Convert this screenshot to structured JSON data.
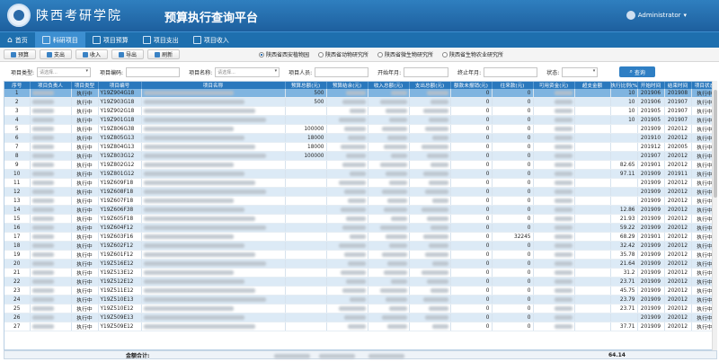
{
  "header": {
    "logo_text": "陕西考研学院",
    "title": "预算执行查询平台",
    "user": "Administrator"
  },
  "nav": [
    {
      "label": "首页",
      "icon": "home-icon"
    },
    {
      "label": "科研项目",
      "icon": "grid-icon"
    },
    {
      "label": "项目预算",
      "icon": "grid-icon"
    },
    {
      "label": "项目支出",
      "icon": "grid-icon"
    },
    {
      "label": "项目收入",
      "icon": "grid-icon"
    }
  ],
  "toolbar": {
    "buttons": [
      "预算",
      "支出",
      "收入",
      "导出",
      "刷新"
    ],
    "radios": [
      "陕西省西安植物园",
      "陕西省动物研究所",
      "陕西省微生物研究所",
      "陕西省生物农业研究所"
    ]
  },
  "filters": {
    "type_label": "项目类型:",
    "type_placeholder": "请选择...",
    "code_label": "项目编码:",
    "name_label": "项目名称:",
    "name_placeholder": "请选择...",
    "person_label": "项目人员:",
    "start_label": "开始年月:",
    "end_label": "终止年月:",
    "status_label": "状态:",
    "query_label": "查询"
  },
  "table": {
    "headers": [
      "序号",
      "项目负责人",
      "项目类型",
      "项目编号",
      "项目名称",
      "预算总额(元)",
      "预算结余(元)",
      "收入总额(元)",
      "支出总额(元)",
      "额款未报销(元)",
      "往来款(元)",
      "可用资金(元)",
      "超支金额",
      "执行比例(%)",
      "开始时间",
      "结束时间",
      "项目状态"
    ],
    "rows": [
      {
        "n": "1",
        "type": "执行中",
        "code": "Y19Z904G18",
        "budget": "500",
        "c8": "0",
        "c9": "0",
        "ratio": "10",
        "start": "201906",
        "end": "201908",
        "status": "执行中"
      },
      {
        "n": "2",
        "type": "执行中",
        "code": "Y19Z903G18",
        "budget": "500",
        "c8": "0",
        "c9": "0",
        "ratio": "10",
        "start": "201906",
        "end": "201907",
        "status": "执行中"
      },
      {
        "n": "3",
        "type": "执行中",
        "code": "Y19Z902G18",
        "budget": "",
        "c8": "0",
        "c9": "0",
        "ratio": "10",
        "start": "201905",
        "end": "201907",
        "status": "执行中"
      },
      {
        "n": "4",
        "type": "执行中",
        "code": "Y19Z901G18",
        "budget": "",
        "c8": "0",
        "c9": "0",
        "ratio": "10",
        "start": "201905",
        "end": "201907",
        "status": "执行中"
      },
      {
        "n": "5",
        "type": "执行中",
        "code": "Y19Z806G38",
        "budget": "100000",
        "c8": "0",
        "c9": "0",
        "ratio": "",
        "start": "201909",
        "end": "202012",
        "status": "执行中"
      },
      {
        "n": "6",
        "type": "执行中",
        "code": "Y19Z805G13",
        "budget": "18000",
        "c8": "0",
        "c9": "0",
        "ratio": "",
        "start": "201910",
        "end": "202012",
        "status": "执行中"
      },
      {
        "n": "7",
        "type": "执行中",
        "code": "Y19Z804G13",
        "budget": "18000",
        "c8": "0",
        "c9": "0",
        "ratio": "",
        "start": "201912",
        "end": "202005",
        "status": "执行中"
      },
      {
        "n": "8",
        "type": "执行中",
        "code": "Y19Z803G12",
        "budget": "100000",
        "c8": "0",
        "c9": "0",
        "ratio": "",
        "start": "201907",
        "end": "202012",
        "status": "执行中"
      },
      {
        "n": "9",
        "type": "执行中",
        "code": "Y19Z802G12",
        "budget": "",
        "c8": "0",
        "c9": "0",
        "ratio": "82.65",
        "start": "201901",
        "end": "202012",
        "status": "执行中"
      },
      {
        "n": "10",
        "type": "执行中",
        "code": "Y19Z801G12",
        "budget": "",
        "c8": "0",
        "c9": "0",
        "ratio": "97.11",
        "start": "201909",
        "end": "201911",
        "status": "执行中"
      },
      {
        "n": "11",
        "type": "执行中",
        "code": "Y19Z609F18",
        "budget": "",
        "c8": "0",
        "c9": "0",
        "ratio": "",
        "start": "201909",
        "end": "202012",
        "status": "执行中"
      },
      {
        "n": "12",
        "type": "执行中",
        "code": "Y19Z608F18",
        "budget": "",
        "c8": "0",
        "c9": "0",
        "ratio": "",
        "start": "201909",
        "end": "202012",
        "status": "执行中"
      },
      {
        "n": "13",
        "type": "执行中",
        "code": "Y19Z607F18",
        "budget": "",
        "c8": "0",
        "c9": "0",
        "ratio": "",
        "start": "201909",
        "end": "202012",
        "status": "执行中"
      },
      {
        "n": "14",
        "type": "执行中",
        "code": "Y19Z606F38",
        "budget": "",
        "c8": "0",
        "c9": "0",
        "ratio": "12.86",
        "start": "201909",
        "end": "202012",
        "status": "执行中"
      },
      {
        "n": "15",
        "type": "执行中",
        "code": "Y19Z605F18",
        "budget": "",
        "c8": "0",
        "c9": "0",
        "ratio": "21.93",
        "start": "201909",
        "end": "202012",
        "status": "执行中"
      },
      {
        "n": "16",
        "type": "执行中",
        "code": "Y19Z604F12",
        "budget": "",
        "c8": "0",
        "c9": "0",
        "ratio": "59.22",
        "start": "201909",
        "end": "202012",
        "status": "执行中"
      },
      {
        "n": "17",
        "type": "执行中",
        "code": "Y19Z603F16",
        "budget": "",
        "c8": "0",
        "c9": "32245",
        "ratio": "68.29",
        "start": "201901",
        "end": "202012",
        "status": "执行中"
      },
      {
        "n": "18",
        "type": "执行中",
        "code": "Y19Z602F12",
        "budget": "",
        "c8": "0",
        "c9": "0",
        "ratio": "32.42",
        "start": "201909",
        "end": "202012",
        "status": "执行中"
      },
      {
        "n": "19",
        "type": "执行中",
        "code": "Y19Z601F12",
        "budget": "",
        "c8": "0",
        "c9": "0",
        "ratio": "35.78",
        "start": "201909",
        "end": "202012",
        "status": "执行中"
      },
      {
        "n": "20",
        "type": "执行中",
        "code": "Y19Z516E12",
        "budget": "",
        "c8": "0",
        "c9": "0",
        "ratio": "21.64",
        "start": "201909",
        "end": "202012",
        "status": "执行中"
      },
      {
        "n": "21",
        "type": "执行中",
        "code": "Y19Z513E12",
        "budget": "",
        "c8": "0",
        "c9": "0",
        "ratio": "31.2",
        "start": "201909",
        "end": "202012",
        "status": "执行中"
      },
      {
        "n": "22",
        "type": "执行中",
        "code": "Y19Z512E12",
        "budget": "",
        "c8": "0",
        "c9": "0",
        "ratio": "23.71",
        "start": "201909",
        "end": "202012",
        "status": "执行中"
      },
      {
        "n": "23",
        "type": "执行中",
        "code": "Y19Z511E12",
        "budget": "",
        "c8": "0",
        "c9": "0",
        "ratio": "45.75",
        "start": "201909",
        "end": "202012",
        "status": "执行中"
      },
      {
        "n": "24",
        "type": "执行中",
        "code": "Y19Z510E13",
        "budget": "",
        "c8": "0",
        "c9": "0",
        "ratio": "23.79",
        "start": "201909",
        "end": "202012",
        "status": "执行中"
      },
      {
        "n": "25",
        "type": "执行中",
        "code": "Y19Z510E12",
        "budget": "",
        "c8": "0",
        "c9": "0",
        "ratio": "23.71",
        "start": "201909",
        "end": "202012",
        "status": "执行中"
      },
      {
        "n": "26",
        "type": "执行中",
        "code": "Y19Z509E13",
        "budget": "",
        "c8": "0",
        "c9": "0",
        "ratio": "",
        "start": "201909",
        "end": "202012",
        "status": "执行中"
      },
      {
        "n": "27",
        "type": "执行中",
        "code": "Y19Z509E12",
        "budget": "",
        "c8": "0",
        "c9": "0",
        "ratio": "37.71",
        "start": "201909",
        "end": "202012",
        "status": "执行中"
      }
    ]
  },
  "footer": {
    "label": "金额合计:",
    "ratio_sum": "64.14"
  },
  "colors": {
    "header": "#1d5f9e",
    "nav": "#1e6fae",
    "table_header": "#2a78bd",
    "row_alt": "#dceaf6",
    "row_selected": "#7fb4e0"
  }
}
